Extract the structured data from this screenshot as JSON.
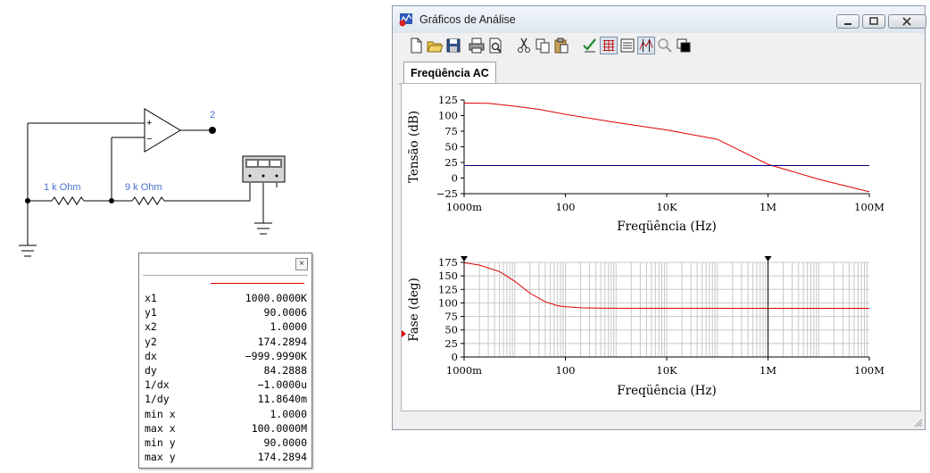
{
  "schematic": {
    "output_node": "2",
    "r1_label": "1 k Ohm",
    "r2_label": "9 k Ohm",
    "opamp_plus": "+",
    "opamp_minus": "−"
  },
  "cursor_readout": {
    "close_symbol": "×",
    "trace_color": "#e00000",
    "rows": [
      {
        "label": "x1",
        "value": "1000.0000K"
      },
      {
        "label": "y1",
        "value": "90.0006"
      },
      {
        "label": "x2",
        "value": "1.0000"
      },
      {
        "label": "y2",
        "value": "174.2894"
      },
      {
        "label": "dx",
        "value": "−999.9990K"
      },
      {
        "label": "dy",
        "value": "84.2888"
      },
      {
        "label": "1/dx",
        "value": "−1.0000u"
      },
      {
        "label": "1/dy",
        "value": "11.8640m"
      },
      {
        "label": "min x",
        "value": "1.0000"
      },
      {
        "label": "max x",
        "value": "100.0000M"
      },
      {
        "label": "min y",
        "value": "90.0000"
      },
      {
        "label": "max y",
        "value": "174.2894"
      }
    ]
  },
  "window": {
    "title": "Gráficos de Análise",
    "tab": "Freqüência AC",
    "toolbar_icons": [
      "new-icon",
      "open-icon",
      "save-icon",
      "print-icon",
      "print-preview-icon",
      "cut-icon",
      "copy-icon",
      "paste-icon",
      "properties-icon",
      "grid-icon",
      "legend-icon",
      "cursors-icon",
      "zoom-icon",
      "reverse-colors-icon"
    ]
  },
  "chart_data": [
    {
      "type": "line",
      "title": "",
      "ylabel": "Tensão (dB)",
      "xlabel": "Freqüência (Hz)",
      "x_scale": "log",
      "xlim": [
        1,
        100000000
      ],
      "ylim": [
        -25,
        125
      ],
      "yticks": [
        "125",
        "100",
        "75",
        "50",
        "25",
        "0",
        "−25"
      ],
      "xticks": [
        "1000m",
        "100",
        "10K",
        "1M",
        "100M"
      ],
      "grid": false,
      "series": [
        {
          "color": "#e00000",
          "x": [
            1,
            3,
            10,
            30,
            100,
            1000,
            10000,
            100000,
            1000000,
            10000000,
            100000000
          ],
          "y": [
            120,
            119.5,
            115,
            110,
            102,
            89,
            77,
            62,
            22,
            -2,
            -22
          ]
        },
        {
          "color": "#00007f",
          "x": [
            1,
            100000000
          ],
          "y": [
            20,
            20
          ]
        }
      ]
    },
    {
      "type": "line",
      "title": "",
      "ylabel": "Fase (deg)",
      "xlabel": "Freqüência (Hz)",
      "x_scale": "log",
      "xlim": [
        1,
        100000000
      ],
      "ylim": [
        0,
        175
      ],
      "yticks": [
        "175",
        "150",
        "125",
        "100",
        "75",
        "50",
        "25",
        "0"
      ],
      "xticks": [
        "1000m",
        "100",
        "10K",
        "1M",
        "100M"
      ],
      "grid": true,
      "cursors_x": [
        1,
        1000000
      ],
      "series": [
        {
          "color": "#e00000",
          "x": [
            1,
            2,
            5,
            10,
            20,
            40,
            70,
            100,
            200,
            500,
            1000,
            100000000
          ],
          "y": [
            174.3,
            170,
            158,
            140,
            118,
            102,
            95,
            93,
            91,
            90.3,
            90.1,
            90
          ]
        }
      ]
    }
  ]
}
